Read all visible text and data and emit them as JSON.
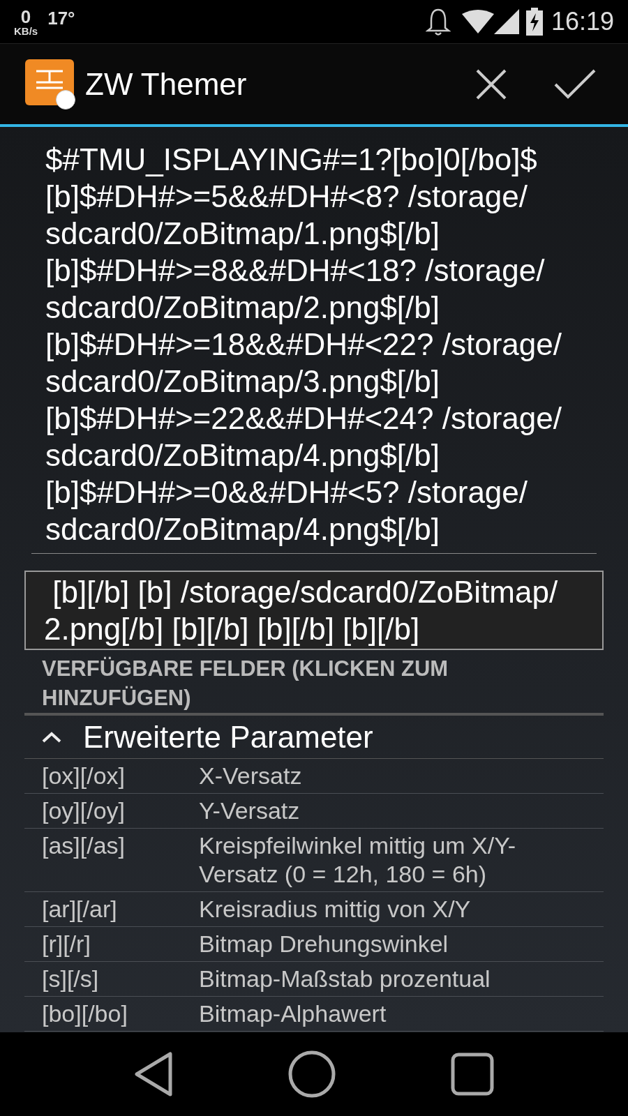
{
  "status_bar": {
    "speed_value": "0",
    "speed_unit": "KB/s",
    "temperature": "17°",
    "time": "16:19"
  },
  "action_bar": {
    "title": "ZW Themer"
  },
  "editor": {
    "value": "$#TMU_ISPLAYING#=1?[bo]0[/bo]$\n[b]$#DH#>=5&&#DH#<8? /storage/sdcard0/ZoBitmap/1.png$[/b]\n[b]$#DH#>=8&&#DH#<18? /storage/sdcard0/ZoBitmap/2.png$[/b]\n[b]$#DH#>=18&&#DH#<22? /storage/sdcard0/ZoBitmap/3.png$[/b]\n[b]$#DH#>=22&&#DH#<24? /storage/sdcard0/ZoBitmap/4.png$[/b]\n[b]$#DH#>=0&&#DH#<5? /storage/sdcard0/ZoBitmap/4.png$[/b]"
  },
  "preview": {
    "value": " [b][/b] [b] /storage/sdcard0/ZoBitmap/2.png[/b] [b][/b] [b][/b] [b][/b]"
  },
  "fields_header": "VERFÜGBARE FELDER (KLICKEN ZUM HINZUFÜGEN)",
  "section": {
    "title": "Erweiterte Parameter",
    "expanded": true,
    "rows": [
      {
        "tag": "[ox][/ox]",
        "description": "X-Versatz"
      },
      {
        "tag": "[oy][/oy]",
        "description": "Y-Versatz"
      },
      {
        "tag": "[as][/as]",
        "description": "Kreispfeilwinkel mittig um X/Y-Versatz (0 = 12h, 180 = 6h)"
      },
      {
        "tag": "[ar][/ar]",
        "description": "Kreisradius mittig von X/Y"
      },
      {
        "tag": "[r][/r]",
        "description": "Bitmap Drehungswinkel"
      },
      {
        "tag": "[s][/s]",
        "description": "Bitmap-Maßstab prozentual"
      },
      {
        "tag": "[bo][/bo]",
        "description": "Bitmap-Alphawert"
      }
    ]
  }
}
